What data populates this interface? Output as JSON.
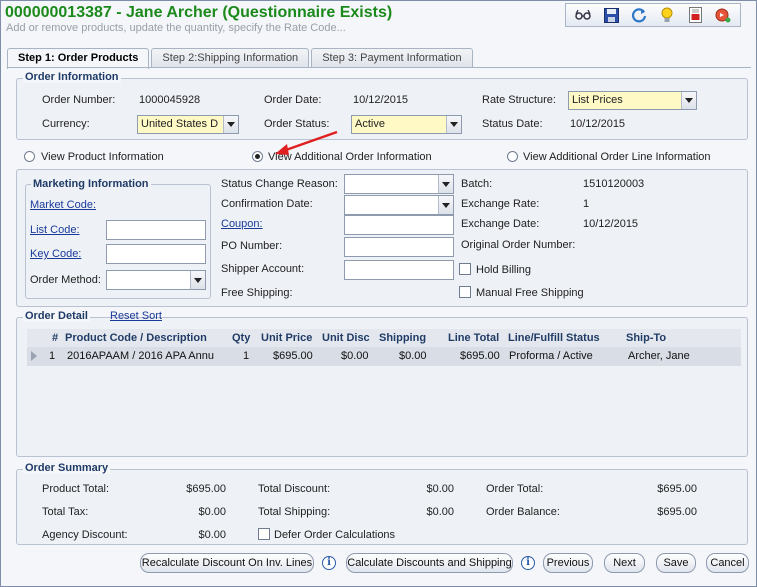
{
  "header": {
    "title": "000000013387 - Jane Archer (Questionnaire Exists)",
    "subtitle": "Add or remove products, update the quantity, specify the Rate Code..."
  },
  "toolbar": {
    "icons": [
      "glasses-icon",
      "save-icon",
      "refresh-icon",
      "lightbulb-icon",
      "report-icon",
      "go-icon"
    ]
  },
  "tabs": [
    {
      "label": "Step 1: Order Products",
      "active": true
    },
    {
      "label": "Step 2:Shipping Information",
      "active": false
    },
    {
      "label": "Step 3: Payment Information",
      "active": false
    }
  ],
  "order_info": {
    "legend": "Order Information",
    "order_number_label": "Order Number:",
    "order_number": "1000045928",
    "order_date_label": "Order Date:",
    "order_date": "10/12/2015",
    "rate_structure_label": "Rate Structure:",
    "rate_structure": "List Prices",
    "currency_label": "Currency:",
    "currency": "United States D",
    "order_status_label": "Order Status:",
    "order_status": "Active",
    "status_date_label": "Status Date:",
    "status_date": "10/12/2015"
  },
  "view_options": {
    "product": "View Product Information",
    "additional_order": "View Additional Order Information",
    "additional_line": "View Additional Order Line Information",
    "selected": "additional_order"
  },
  "marketing": {
    "legend": "Marketing Information",
    "market_code": "Market Code:",
    "list_code": "List Code:",
    "key_code": "Key Code:",
    "order_method": "Order Method:"
  },
  "additional": {
    "status_change_reason": "Status Change Reason:",
    "confirmation_date": "Confirmation Date:",
    "coupon": "Coupon:",
    "po_number": "PO Number:",
    "shipper_account": "Shipper Account:",
    "free_shipping": "Free Shipping:",
    "batch_label": "Batch:",
    "batch": "1510120003",
    "exchange_rate_label": "Exchange Rate:",
    "exchange_rate": "1",
    "exchange_date_label": "Exchange Date:",
    "exchange_date": "10/12/2015",
    "original_order_label": "Original Order Number:",
    "hold_billing": "Hold Billing",
    "manual_free_shipping": "Manual Free Shipping"
  },
  "order_detail": {
    "legend": "Order Detail",
    "reset_sort": "Reset Sort",
    "columns": [
      "#",
      "Product Code / Description",
      "Qty",
      "Unit Price",
      "Unit Disc",
      "Shipping",
      "Line Total",
      "Line/Fulfill Status",
      "Ship-To"
    ],
    "rows": [
      {
        "num": "1",
        "product": "2016APAAM / 2016 APA Annu",
        "qty": "1",
        "unit_price": "$695.00",
        "unit_disc": "$0.00",
        "shipping": "$0.00",
        "line_total": "$695.00",
        "status": "Proforma / Active",
        "ship_to": "Archer, Jane"
      }
    ]
  },
  "summary": {
    "legend": "Order Summary",
    "product_total_label": "Product Total:",
    "product_total": "$695.00",
    "total_tax_label": "Total Tax:",
    "total_tax": "$0.00",
    "agency_discount_label": "Agency Discount:",
    "agency_discount": "$0.00",
    "total_discount_label": "Total Discount:",
    "total_discount": "$0.00",
    "total_shipping_label": "Total Shipping:",
    "total_shipping": "$0.00",
    "defer_label": "Defer Order Calculations",
    "order_total_label": "Order Total:",
    "order_total": "$695.00",
    "order_balance_label": "Order Balance:",
    "order_balance": "$695.00"
  },
  "buttons": {
    "recalculate": "Recalculate Discount On Inv. Lines",
    "calculate": "Calculate Discounts and Shipping",
    "previous": "Previous",
    "next": "Next",
    "save": "Save",
    "cancel": "Cancel"
  },
  "colors": {
    "title": "#1b8a1b",
    "arrow": "#e02020",
    "highlight_field": "#fff9c6"
  }
}
